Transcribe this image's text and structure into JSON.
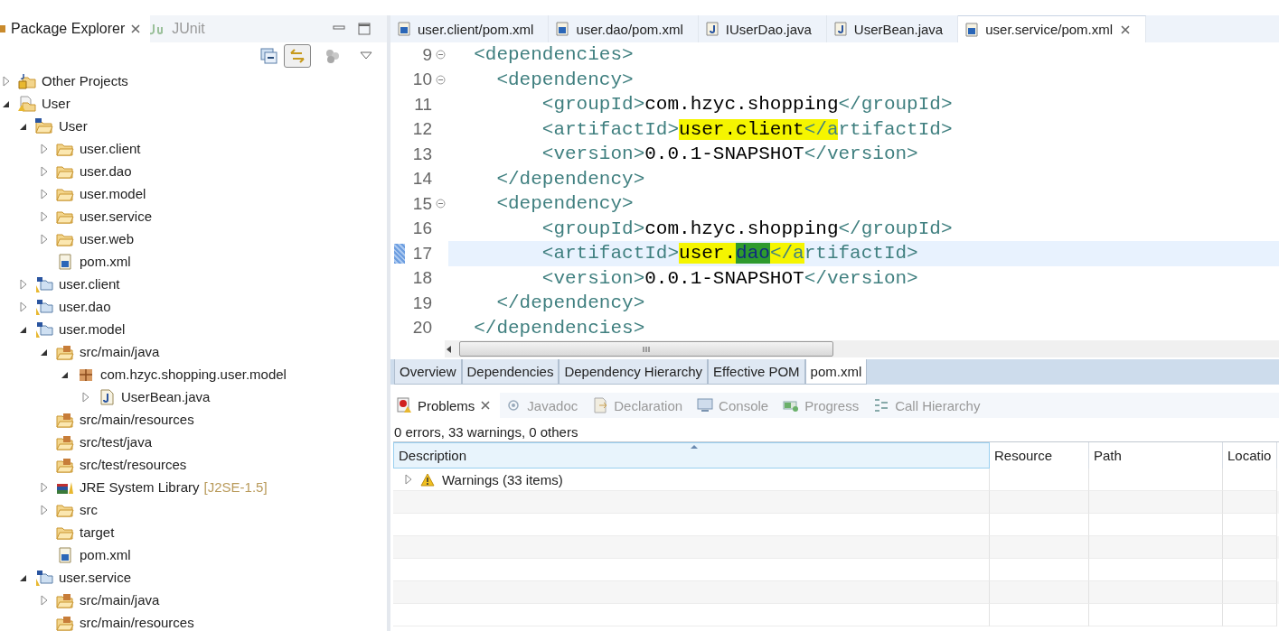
{
  "left_view": {
    "tabs": [
      {
        "label": "Package Explorer",
        "kind": "package",
        "selected": true
      },
      {
        "label": "JUnit",
        "kind": "junit",
        "selected": false
      }
    ],
    "tree": [
      {
        "label": "Other Projects",
        "kind": "working-set",
        "expanded": false
      },
      {
        "label": "User",
        "kind": "working-set-warn",
        "expanded": true,
        "children": [
          {
            "label": "User",
            "kind": "maven-folder",
            "expanded": true,
            "children": [
              {
                "label": "user.client",
                "kind": "folder",
                "expanded": false
              },
              {
                "label": "user.dao",
                "kind": "folder",
                "expanded": false
              },
              {
                "label": "user.model",
                "kind": "folder",
                "expanded": false
              },
              {
                "label": "user.service",
                "kind": "folder",
                "expanded": false
              },
              {
                "label": "user.web",
                "kind": "folder",
                "expanded": false
              },
              {
                "label": "pom.xml",
                "kind": "pom"
              }
            ]
          },
          {
            "label": "user.client",
            "kind": "maven-project",
            "expanded": false
          },
          {
            "label": "user.dao",
            "kind": "maven-project",
            "expanded": false
          },
          {
            "label": "user.model",
            "kind": "maven-project",
            "expanded": true,
            "children": [
              {
                "label": "src/main/java",
                "kind": "source-folder",
                "expanded": true,
                "children": [
                  {
                    "label": "com.hzyc.shopping.user.model",
                    "kind": "package",
                    "expanded": true,
                    "children": [
                      {
                        "label": "UserBean.java",
                        "kind": "java",
                        "expanded": false
                      }
                    ]
                  }
                ]
              },
              {
                "label": "src/main/resources",
                "kind": "source-folder"
              },
              {
                "label": "src/test/java",
                "kind": "source-folder"
              },
              {
                "label": "src/test/resources",
                "kind": "source-folder"
              },
              {
                "label": "JRE System Library",
                "suffix": "[J2SE-1.5]",
                "kind": "library",
                "expanded": false
              },
              {
                "label": "src",
                "kind": "folder",
                "expanded": false
              },
              {
                "label": "target",
                "kind": "folder"
              },
              {
                "label": "pom.xml",
                "kind": "pom"
              }
            ]
          },
          {
            "label": "user.service",
            "kind": "maven-project",
            "expanded": true,
            "children": [
              {
                "label": "src/main/java",
                "kind": "source-folder",
                "expanded": false
              },
              {
                "label": "src/main/resources",
                "kind": "source-folder"
              }
            ]
          }
        ]
      }
    ]
  },
  "editor": {
    "tabs": [
      {
        "label": "user.client/pom.xml",
        "kind": "pom",
        "selected": false
      },
      {
        "label": "user.dao/pom.xml",
        "kind": "pom",
        "selected": false
      },
      {
        "label": "IUserDao.java",
        "kind": "java",
        "selected": false
      },
      {
        "label": "UserBean.java",
        "kind": "java",
        "selected": false
      },
      {
        "label": "user.service/pom.xml",
        "kind": "pom",
        "selected": true
      }
    ],
    "lines": [
      {
        "number": "9",
        "foldable": true,
        "current": false,
        "segments": [
          {
            "kind": "tag",
            "text": "  <dependencies>",
            "marked": false,
            "selected": false
          }
        ]
      },
      {
        "number": "10",
        "foldable": true,
        "current": false,
        "segments": [
          {
            "kind": "tag",
            "text": "    <dependency>",
            "marked": false,
            "selected": false
          }
        ]
      },
      {
        "number": "11",
        "foldable": false,
        "current": false,
        "segments": [
          {
            "kind": "tag",
            "text": "        <groupId>",
            "marked": false,
            "selected": false
          },
          {
            "kind": "text",
            "text": "com.hzyc.shopping",
            "marked": false,
            "selected": false
          },
          {
            "kind": "tag",
            "text": "</groupId>",
            "marked": false,
            "selected": false
          }
        ]
      },
      {
        "number": "12",
        "foldable": false,
        "current": false,
        "segments": [
          {
            "kind": "tag",
            "text": "        <artifactId>",
            "marked": false,
            "selected": false
          },
          {
            "kind": "text",
            "text": "user.client",
            "marked": true,
            "selected": false
          },
          {
            "kind": "tag",
            "text": "</a",
            "marked": true,
            "selected": false
          },
          {
            "kind": "tag",
            "text": "rtifactId>",
            "marked": false,
            "selected": false
          }
        ]
      },
      {
        "number": "13",
        "foldable": false,
        "current": false,
        "segments": [
          {
            "kind": "tag",
            "text": "        <version>",
            "marked": false,
            "selected": false
          },
          {
            "kind": "text",
            "text": "0.0.1-SNAPSHOT",
            "marked": false,
            "selected": false
          },
          {
            "kind": "tag",
            "text": "</version>",
            "marked": false,
            "selected": false
          }
        ]
      },
      {
        "number": "14",
        "foldable": false,
        "current": false,
        "segments": [
          {
            "kind": "tag",
            "text": "    </dependency>",
            "marked": false,
            "selected": false
          }
        ]
      },
      {
        "number": "15",
        "foldable": true,
        "current": false,
        "segments": [
          {
            "kind": "tag",
            "text": "    <dependency>",
            "marked": false,
            "selected": false
          }
        ]
      },
      {
        "number": "16",
        "foldable": false,
        "current": false,
        "segments": [
          {
            "kind": "tag",
            "text": "        <groupId>",
            "marked": false,
            "selected": false
          },
          {
            "kind": "text",
            "text": "com.hzyc.shopping",
            "marked": false,
            "selected": false
          },
          {
            "kind": "tag",
            "text": "</groupId>",
            "marked": false,
            "selected": false
          }
        ]
      },
      {
        "number": "17",
        "foldable": false,
        "current": true,
        "segments": [
          {
            "kind": "tag",
            "text": "        <artifactId>",
            "marked": false,
            "selected": false
          },
          {
            "kind": "text",
            "text": "user.",
            "marked": true,
            "selected": false
          },
          {
            "kind": "text",
            "text": "dao",
            "marked": false,
            "selected": true
          },
          {
            "kind": "tag",
            "text": "</a",
            "marked": true,
            "selected": false
          },
          {
            "kind": "tag",
            "text": "rtifactId>",
            "marked": false,
            "selected": false
          }
        ]
      },
      {
        "number": "18",
        "foldable": false,
        "current": false,
        "segments": [
          {
            "kind": "tag",
            "text": "        <version>",
            "marked": false,
            "selected": false
          },
          {
            "kind": "text",
            "text": "0.0.1-SNAPSHOT",
            "marked": false,
            "selected": false
          },
          {
            "kind": "tag",
            "text": "</version>",
            "marked": false,
            "selected": false
          }
        ]
      },
      {
        "number": "19",
        "foldable": false,
        "current": false,
        "segments": [
          {
            "kind": "tag",
            "text": "    </dependency>",
            "marked": false,
            "selected": false
          }
        ]
      },
      {
        "number": "20",
        "foldable": false,
        "current": false,
        "segments": [
          {
            "kind": "tag",
            "text": "  </dependencies>",
            "marked": false,
            "selected": false
          }
        ]
      }
    ],
    "page_tabs": [
      {
        "label": "Overview",
        "selected": false
      },
      {
        "label": "Dependencies",
        "selected": false
      },
      {
        "label": "Dependency Hierarchy",
        "selected": false
      },
      {
        "label": "Effective POM",
        "selected": false
      },
      {
        "label": "pom.xml",
        "selected": true
      }
    ]
  },
  "bottom_view": {
    "tabs": [
      {
        "label": "Problems",
        "kind": "problems",
        "selected": true
      },
      {
        "label": "Javadoc",
        "kind": "javadoc",
        "selected": false
      },
      {
        "label": "Declaration",
        "kind": "declaration",
        "selected": false
      },
      {
        "label": "Console",
        "kind": "console",
        "selected": false
      },
      {
        "label": "Progress",
        "kind": "progress",
        "selected": false
      },
      {
        "label": "Call Hierarchy",
        "kind": "call-hierarchy",
        "selected": false
      }
    ],
    "summary": "0 errors, 33 warnings, 0 others",
    "columns": [
      {
        "label": "Description",
        "sorted": true
      },
      {
        "label": "Resource",
        "sorted": false
      },
      {
        "label": "Path",
        "sorted": false
      },
      {
        "label": "Locatio",
        "sorted": false
      }
    ],
    "rows": [
      {
        "kind": "warning",
        "label": "Warnings (33 items)",
        "expanded": false
      }
    ]
  }
}
